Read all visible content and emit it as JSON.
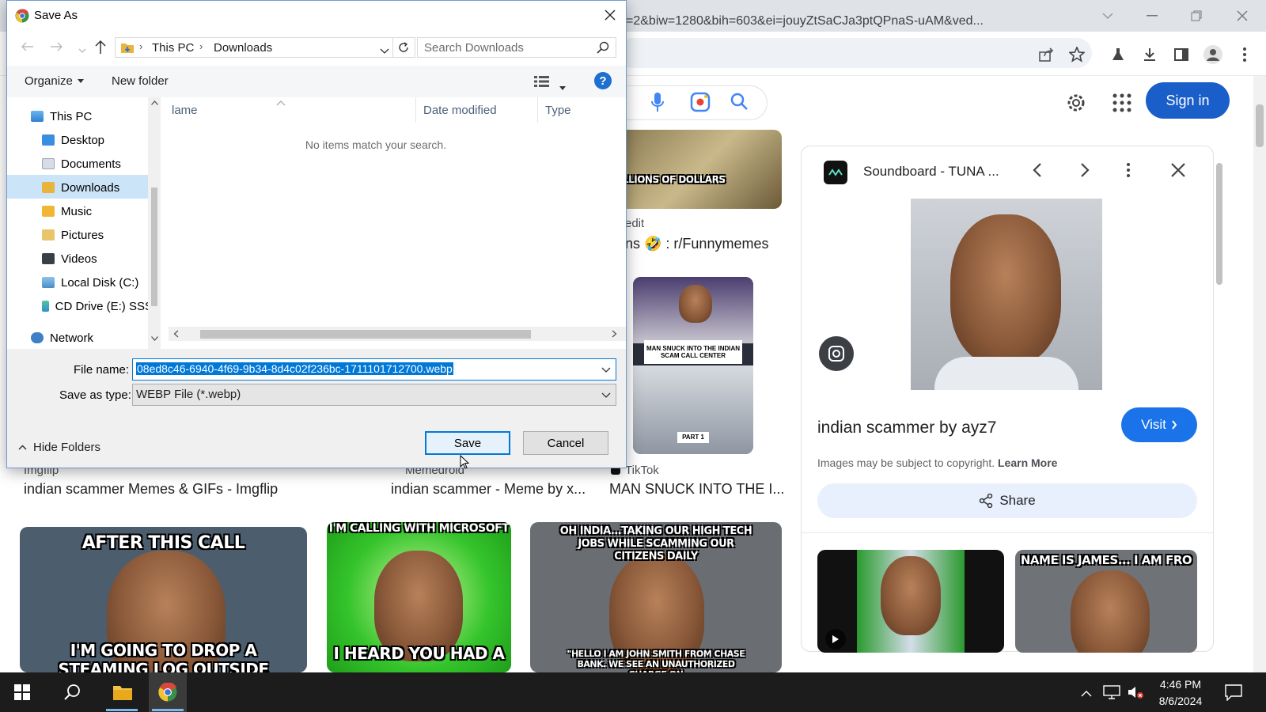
{
  "browser": {
    "url": "=2&biw=1280&bih=603&ei=jouyZtSaCJa3ptQPnaS-uAM&ved...",
    "signin_label": "Sign in",
    "results": [
      {
        "source": "Imgflip",
        "title": "indian scammer Memes & GIFs - Imgflip"
      },
      {
        "source": "Memedroid",
        "title": "indian scammer - Meme by x..."
      },
      {
        "source": "TikTok",
        "title": "MAN SNUCK INTO THE I..."
      },
      {
        "source": "edit",
        "title": "ns 🤣 : r/Funnymemes"
      }
    ],
    "thumbs": {
      "millions": "MILLIONS OF DOLLARS",
      "tiktok_top": "MAN SNUCK INTO THE INDIAN SCAM CALL CENTER",
      "tiktok_part": "PART 1",
      "meme1_top": "AFTER THIS CALL",
      "meme1_bottom": "I'M GOING TO DROP A STEAMING LOG OUTSIDE BEHIND THE BUILDING",
      "meme2_top": "I'M CALLING WITH MICROSOFT",
      "meme2_bottom": "I HEARD YOU HAD A",
      "meme3_top": "OH INDIA...TAKING OUR HIGH TECH JOBS WHILE SCAMMING OUR CITIZENS DAILY",
      "meme3_bottom": "\"HELLO I AM JOHN SMITH FROM CHASE BANK. WE SEE AN UNAUTHORIZED CHARGE ON"
    },
    "panel": {
      "site": "Soundboard - TUNA ...",
      "title": "indian scammer by ayz7",
      "visit": "Visit",
      "copyright": "Images may be subject to copyright.",
      "learn_more": "Learn More",
      "share": "Share",
      "related2_text": "NAME IS JAMES... I AM FRO"
    }
  },
  "dialog": {
    "title": "Save As",
    "breadcrumb": [
      "This PC",
      "Downloads"
    ],
    "search_placeholder": "Search Downloads",
    "organize": "Organize",
    "new_folder": "New folder",
    "nav": [
      "This PC",
      "Desktop",
      "Documents",
      "Downloads",
      "Music",
      "Pictures",
      "Videos",
      "Local Disk (C:)",
      "CD Drive (E:) SSS",
      "Network"
    ],
    "columns": [
      "lame",
      "Date modified",
      "Type"
    ],
    "empty_message": "No items match your search.",
    "file_name_label": "File name:",
    "file_name_value": "08ed8c46-6940-4f69-9b34-8d4c02f236bc-1711101712700.webp",
    "save_type_label": "Save as type:",
    "save_type_value": "WEBP File (*.webp)",
    "hide_folders": "Hide Folders",
    "save": "Save",
    "cancel": "Cancel"
  },
  "taskbar": {
    "time": "4:46 PM",
    "date": "8/6/2024"
  },
  "colors": {
    "accent_blue": "#1a73e8",
    "signin_blue": "#1a5ec9",
    "selection_blue": "#0078d7",
    "taskbar": "#1c1c1c"
  }
}
